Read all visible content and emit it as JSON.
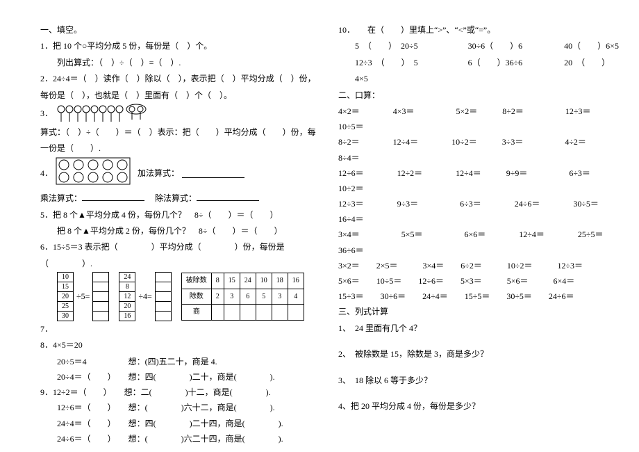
{
  "section_a": "一、填空。",
  "q1": {
    "line1": "1．把 10 个○平均分成 5 份，每份是（　）个。",
    "line2": "列出算式：（　）÷（　）=（　）."
  },
  "q2": "2．24÷4＝（　）读作（　）除以（　），表示把（　）平均分成（　）份，每份是（　），也就是（　）里面有（　）个（　）。",
  "q3_line2": "算式：（　）÷（　　）＝（　）表示：把（　　）平均分成（　　）份，每一份是（　　）.",
  "q4_add": "加法算式：",
  "q4_mul": "乘法算式：",
  "q4_div": "除法算式：",
  "q5a": "5．把 8 个▲平均分成 4 份，每份几个？　8÷（　　）＝（　　）",
  "q5b": "把 8 个▲平均分成 2 份，每份几个？　8÷（　　）＝（　　）",
  "q6": "6．15÷5＝3 表示把（　　　　）平均分成（　　　　）份，每份是（　　　　）.",
  "stack1": [
    "10",
    "15",
    "20",
    "25",
    "30"
  ],
  "stack2": [
    "24",
    "8",
    "12",
    "20",
    "16"
  ],
  "table_head": [
    "被除数",
    "8",
    "15",
    "24",
    "10",
    "18",
    "16"
  ],
  "table_r2": [
    "除数",
    "2",
    "3",
    "6",
    "5",
    "3",
    "4"
  ],
  "table_r3": [
    "商",
    "",
    "",
    "",
    "",
    "",
    ""
  ],
  "q8h": "8．4×5＝20",
  "q8a": "20÷5＝4　　　　　想：(四)五二十，商是 4.",
  "q8b": "20÷4＝（　　）　　想：四(　　　　)二十，商是(　　　　).",
  "q9h": "9．12÷2＝（　　）　　想：二(　　　　)十二，商是(　　　　).",
  "q9a": "12÷6＝（　　）　　想：(　　　　)六十二，商是(　　　　).",
  "q9b": "24÷4＝（　　）　　想：四(　　　　)二十四，商是(　　　　).",
  "q9c": "24÷6＝（　　）　　想：(　　　　)六二十四，商是(　　　　).",
  "q10h": "10．　　在（　　）里填上“>”、“<”或“=”。",
  "q10a": "5　（　　）　20÷5　　　　　　30÷6（　　）6　　　　　40（　　）6×5",
  "q10b": "12÷3　（　　）　5　　　　　　6（　　）36÷6　　　　　20　（　　）4×5",
  "section_b": "二、口算：",
  "rowsB": [
    "4×2＝　　　　4×3＝　　　　　5×2＝　　　8÷2＝　　　　　12÷3＝　　　　10÷5＝",
    "8÷2＝　　　　12÷4＝　　　　10÷2＝　　　3÷3＝　　　　　4÷2＝　　　　8÷4＝",
    "12÷6＝　　　　12÷2＝　　　　12÷4＝　　　9÷9＝　　　　　6÷3＝　　　　10÷2＝",
    "12÷3＝　　　　9÷3＝　　　　　6÷3＝　　　　24÷6＝　　　　30÷5＝　　　　16÷4＝",
    "3×4＝　　　　　5×5＝　　　　　6×6＝　　　　12÷4＝　　　　25÷5＝　　　　36÷6＝",
    "3×2＝　　2×5＝　　　3×4＝　　6÷2＝　　　10÷2＝　　　12÷3＝",
    "5×6＝　　10÷5＝　　12÷6＝　　5×3＝　　　5×6＝　　　6×4＝",
    "15÷3＝　　30÷6＝　　24÷4＝　　15÷5＝　　30÷5＝　　24÷6＝"
  ],
  "section_c": "三、列式计算",
  "c1": "1、　24 里面有几个 4？",
  "c2": "2、　被除数是 15，除数是 3，商是多少？",
  "c3": "3、　18 除以 6 等于多少？",
  "c4": "4、把 20 平均分成 4 份，每份是多少？"
}
